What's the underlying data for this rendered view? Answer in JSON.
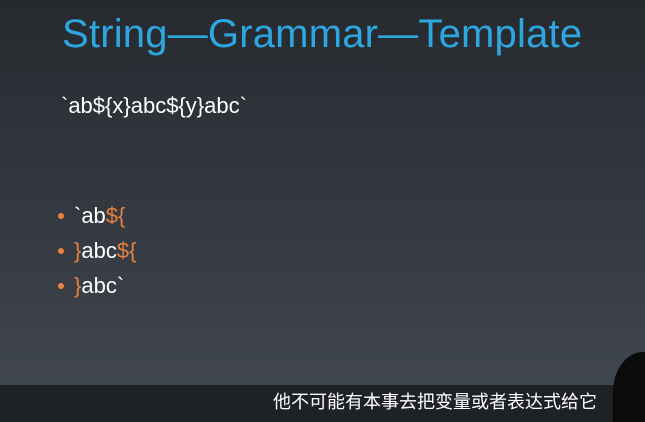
{
  "slide": {
    "title": "String—Grammar—Template",
    "expression": "`ab${x}abc${y}abc`",
    "parts": [
      {
        "segments": [
          {
            "text": "`ab",
            "accent": false
          },
          {
            "text": "${",
            "accent": true
          }
        ]
      },
      {
        "segments": [
          {
            "text": "}",
            "accent": true
          },
          {
            "text": "abc",
            "accent": false
          },
          {
            "text": "${",
            "accent": true
          }
        ]
      },
      {
        "segments": [
          {
            "text": "}",
            "accent": true
          },
          {
            "text": "abc`",
            "accent": false
          }
        ]
      }
    ]
  },
  "subtitle": {
    "text": "他不可能有本事去把变量或者表达式给它"
  },
  "colors": {
    "title": "#2ea7e0",
    "accent": "#e8823e",
    "text": "#ffffff",
    "subtitle_bar": "#1e2125"
  }
}
